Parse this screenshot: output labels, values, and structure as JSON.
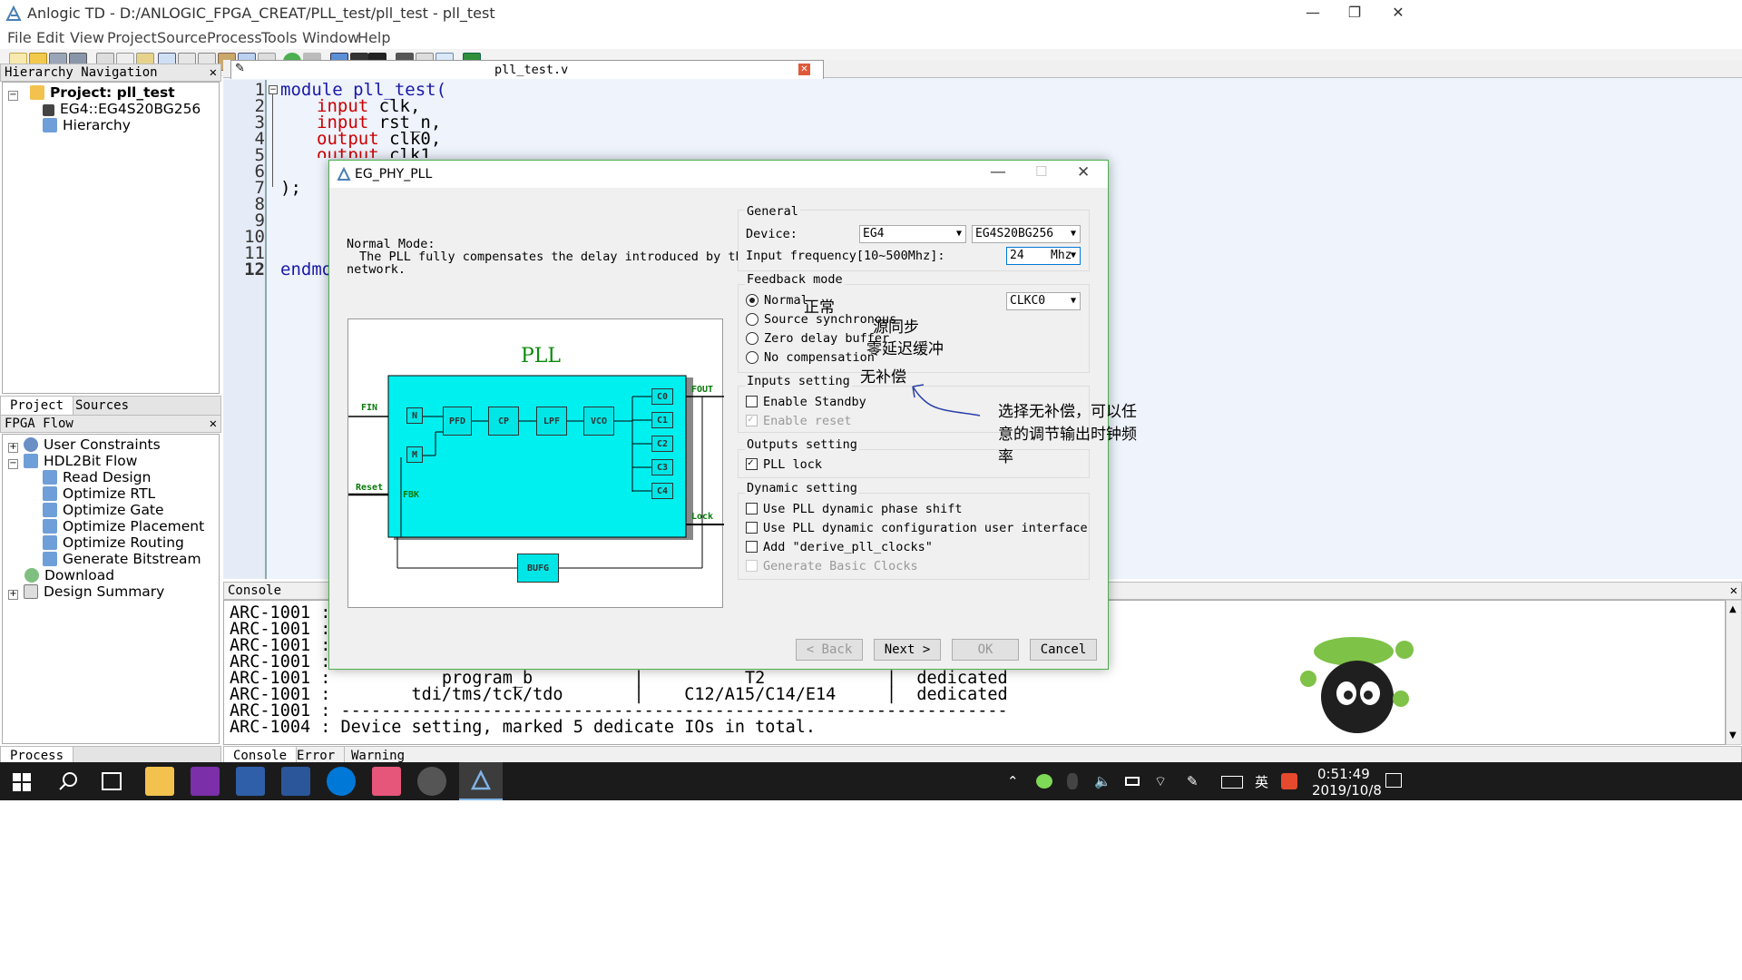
{
  "window": {
    "title": "Anlogic TD - D:/ANLOGIC_FPGA_CREAT/PLL_test/pll_test - pll_test",
    "minimize": "—",
    "restore": "❐",
    "close": "✕"
  },
  "menu": [
    "File",
    "Edit",
    "View",
    "Project",
    "Source",
    "Process",
    "Tools",
    "Window",
    "Help"
  ],
  "hierarchy": {
    "title": "Hierarchy Navigation",
    "project": "Project: pll_test",
    "device": "EG4::EG4S20BG256",
    "item": "Hierarchy",
    "tabs": [
      "Project",
      "Sources"
    ]
  },
  "fpga_flow": {
    "title": "FPGA Flow",
    "items": [
      "User Constraints",
      "HDL2Bit Flow",
      "Read Design",
      "Optimize RTL",
      "Optimize Gate",
      "Optimize Placement",
      "Optimize Routing",
      "Generate Bitstream",
      "Download",
      "Design Summary"
    ],
    "tab": "Process"
  },
  "editor": {
    "tab": "pll_test.v",
    "line_numbers": [
      "1",
      "2",
      "3",
      "4",
      "5",
      "6",
      "7",
      "8",
      "9",
      "10",
      "11",
      "12"
    ],
    "l1": "module pll_test(",
    "l2_kw": "input",
    "l2": " clk,",
    "l3_kw": "input",
    "l3": " rst_n,",
    "l4_kw": "output",
    "l4": " clk0,",
    "l5_kw": "output",
    "l5": " clk1",
    "l7": ");",
    "l12": "endmod"
  },
  "console": {
    "title": "Console",
    "lines": [
      "ARC-1001 :",
      "ARC-1001 :",
      "ARC-1001 :",
      "ARC-1001 :",
      "ARC-1001 :           program_b          |          T2            |  dedicated",
      "ARC-1001 :        tdi/tms/tck/tdo       |    C12/A15/C14/E14     |  dedicated",
      "ARC-1001 : ------------------------------------------------------------------",
      "ARC-1004 : Device setting, marked 5 dedicate IOs in total."
    ],
    "tabs": [
      "Console",
      "Error",
      "Warning"
    ]
  },
  "dialog": {
    "title": "EG_PHY_PLL",
    "mode_title": "Normal Mode:",
    "mode_desc_1": "The PLL fully compensates the delay introduced by the GCLK",
    "mode_desc_2": "network.",
    "diagram": {
      "title": "PLL",
      "fin": "FIN",
      "reset": "Reset",
      "fbk": "FBK",
      "fout": "FOUT",
      "lock": "Lock",
      "n": "N",
      "m": "M",
      "pfd": "PFD",
      "cp": "CP",
      "lpf": "LPF",
      "vco": "VCO",
      "outs": [
        "C0",
        "C1",
        "C2",
        "C3",
        "C4"
      ],
      "bufg": "BUFG"
    },
    "general": {
      "title": "General",
      "device_label": "Device:",
      "device_family": "EG4",
      "device_part": "EG4S20BG256",
      "freq_label": "Input frequency[10~500Mhz]:",
      "freq_value": "24",
      "freq_unit": "Mhz"
    },
    "feedback": {
      "title": "Feedback mode",
      "options": [
        "Normal",
        "Source synchronous",
        "Zero delay buffer",
        "No compensation"
      ],
      "selected": 0,
      "clock": "CLKC0"
    },
    "inputs": {
      "title": "Inputs setting",
      "standby": "Enable Standby",
      "reset": "Enable reset"
    },
    "outputs": {
      "title": "Outputs setting",
      "lock": "PLL lock"
    },
    "dynamic": {
      "title": "Dynamic setting",
      "phase": "Use PLL dynamic phase shift",
      "config": "Use PLL dynamic configuration user interface",
      "derive": "Add \"derive_pll_clocks\"",
      "basic": "Generate Basic Clocks"
    },
    "buttons": {
      "back": "< Back",
      "next": "Next >",
      "ok": "OK",
      "cancel": "Cancel"
    }
  },
  "annotations": {
    "normal": "正常",
    "source_sync": "源同步",
    "zero_delay": "零延迟缓冲",
    "no_comp": "无补偿",
    "note_1": "选择无补偿，可以任",
    "note_2": "意的调节输出时钟频",
    "note_3": "率"
  },
  "taskbar": {
    "ime": "英",
    "time": "0:51:49",
    "date": "2019/10/8"
  }
}
